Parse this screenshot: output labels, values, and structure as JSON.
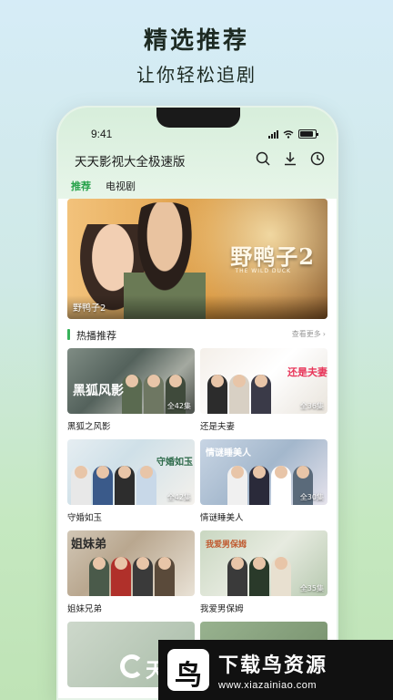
{
  "promo": {
    "title": "精选推荐",
    "subtitle": "让你轻松追剧"
  },
  "status_bar": {
    "time": "9:41"
  },
  "app": {
    "title": "天天影视大全极速版",
    "icons": [
      "search-icon",
      "download-icon",
      "history-icon"
    ]
  },
  "tabs": [
    {
      "label": "推荐",
      "active": true
    },
    {
      "label": "电视剧",
      "active": false
    }
  ],
  "banner": {
    "caption": "野鸭子2",
    "logo_text": "野鸭子2",
    "logo_en": "THE WILD DUCK"
  },
  "section": {
    "title": "热播推荐",
    "more": "查看更多"
  },
  "shows": [
    {
      "title": "黑狐之风影",
      "episodes": "全42集",
      "poster_text": "黑狐风影"
    },
    {
      "title": "还是夫妻",
      "episodes": "全36集",
      "poster_text": "还是夫妻"
    },
    {
      "title": "守婚如玉",
      "episodes": "全42集",
      "poster_text": "守婚如玉"
    },
    {
      "title": "情谜睡美人",
      "episodes": "全30集",
      "poster_text": "情谜睡美人"
    },
    {
      "title": "姐妹兄弟",
      "episodes": "",
      "poster_text": "姐妹弟"
    },
    {
      "title": "我爱男保姆",
      "episodes": "全35集",
      "poster_text": "我爱男保姆"
    },
    {
      "title": "",
      "episodes": "",
      "poster_text": ""
    },
    {
      "title": "",
      "episodes": "",
      "poster_text": ""
    }
  ],
  "watermark": {
    "name": "下载鸟资源",
    "url": "www.xiazainiao.com",
    "logo_char": "鸟"
  },
  "bottom_logo_text": "天"
}
